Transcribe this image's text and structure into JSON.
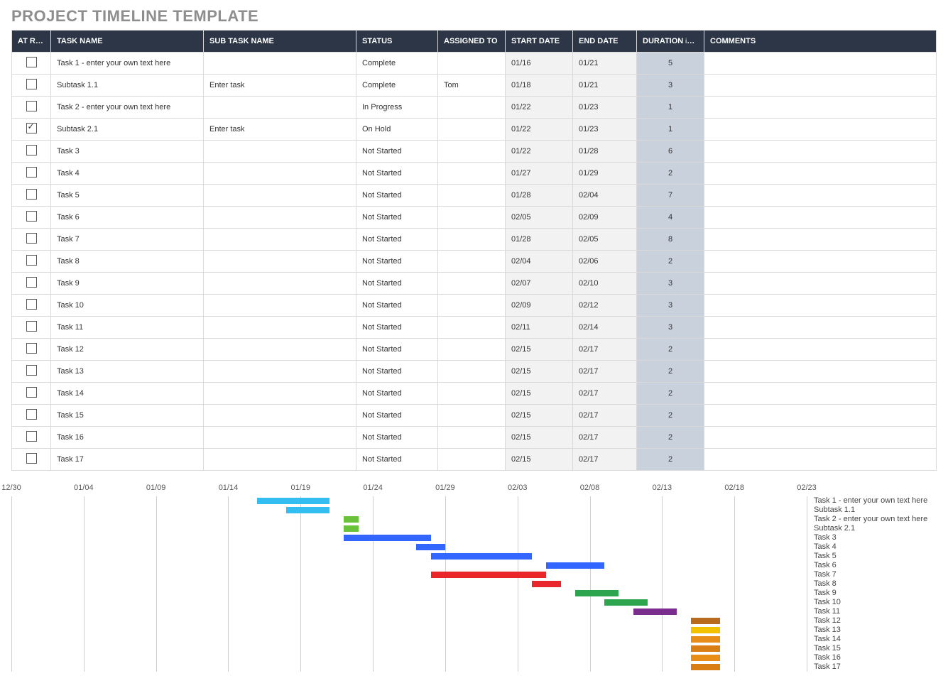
{
  "title": "PROJECT TIMELINE TEMPLATE",
  "columns": {
    "at_risk": "AT RISK",
    "task_name": "TASK NAME",
    "sub_task_name": "SUB TASK NAME",
    "status": "STATUS",
    "assigned_to": "ASSIGNED TO",
    "start_date": "START DATE",
    "end_date": "END DATE",
    "duration": "DURATION",
    "duration_sub": " in days",
    "comments": "COMMENTS"
  },
  "rows": [
    {
      "at_risk": false,
      "task": "Task 1 - enter your own text here",
      "sub": "",
      "status": "Complete",
      "assigned": "",
      "start": "01/16",
      "end": "01/21",
      "duration": "5",
      "comments": ""
    },
    {
      "at_risk": false,
      "task": "Subtask 1.1",
      "sub": "Enter task",
      "status": "Complete",
      "assigned": "Tom",
      "start": "01/18",
      "end": "01/21",
      "duration": "3",
      "comments": ""
    },
    {
      "at_risk": false,
      "task": "Task 2 - enter your own text here",
      "sub": "",
      "status": "In Progress",
      "assigned": "",
      "start": "01/22",
      "end": "01/23",
      "duration": "1",
      "comments": ""
    },
    {
      "at_risk": true,
      "task": "Subtask 2.1",
      "sub": "Enter task",
      "status": "On Hold",
      "assigned": "",
      "start": "01/22",
      "end": "01/23",
      "duration": "1",
      "comments": ""
    },
    {
      "at_risk": false,
      "task": "Task 3",
      "sub": "",
      "status": "Not Started",
      "assigned": "",
      "start": "01/22",
      "end": "01/28",
      "duration": "6",
      "comments": ""
    },
    {
      "at_risk": false,
      "task": "Task 4",
      "sub": "",
      "status": "Not Started",
      "assigned": "",
      "start": "01/27",
      "end": "01/29",
      "duration": "2",
      "comments": ""
    },
    {
      "at_risk": false,
      "task": "Task 5",
      "sub": "",
      "status": "Not Started",
      "assigned": "",
      "start": "01/28",
      "end": "02/04",
      "duration": "7",
      "comments": ""
    },
    {
      "at_risk": false,
      "task": "Task 6",
      "sub": "",
      "status": "Not Started",
      "assigned": "",
      "start": "02/05",
      "end": "02/09",
      "duration": "4",
      "comments": ""
    },
    {
      "at_risk": false,
      "task": "Task 7",
      "sub": "",
      "status": "Not Started",
      "assigned": "",
      "start": "01/28",
      "end": "02/05",
      "duration": "8",
      "comments": ""
    },
    {
      "at_risk": false,
      "task": "Task 8",
      "sub": "",
      "status": "Not Started",
      "assigned": "",
      "start": "02/04",
      "end": "02/06",
      "duration": "2",
      "comments": ""
    },
    {
      "at_risk": false,
      "task": "Task 9",
      "sub": "",
      "status": "Not Started",
      "assigned": "",
      "start": "02/07",
      "end": "02/10",
      "duration": "3",
      "comments": ""
    },
    {
      "at_risk": false,
      "task": "Task 10",
      "sub": "",
      "status": "Not Started",
      "assigned": "",
      "start": "02/09",
      "end": "02/12",
      "duration": "3",
      "comments": ""
    },
    {
      "at_risk": false,
      "task": "Task 11",
      "sub": "",
      "status": "Not Started",
      "assigned": "",
      "start": "02/11",
      "end": "02/14",
      "duration": "3",
      "comments": ""
    },
    {
      "at_risk": false,
      "task": "Task 12",
      "sub": "",
      "status": "Not Started",
      "assigned": "",
      "start": "02/15",
      "end": "02/17",
      "duration": "2",
      "comments": ""
    },
    {
      "at_risk": false,
      "task": "Task 13",
      "sub": "",
      "status": "Not Started",
      "assigned": "",
      "start": "02/15",
      "end": "02/17",
      "duration": "2",
      "comments": ""
    },
    {
      "at_risk": false,
      "task": "Task 14",
      "sub": "",
      "status": "Not Started",
      "assigned": "",
      "start": "02/15",
      "end": "02/17",
      "duration": "2",
      "comments": ""
    },
    {
      "at_risk": false,
      "task": "Task 15",
      "sub": "",
      "status": "Not Started",
      "assigned": "",
      "start": "02/15",
      "end": "02/17",
      "duration": "2",
      "comments": ""
    },
    {
      "at_risk": false,
      "task": "Task 16",
      "sub": "",
      "status": "Not Started",
      "assigned": "",
      "start": "02/15",
      "end": "02/17",
      "duration": "2",
      "comments": ""
    },
    {
      "at_risk": false,
      "task": "Task 17",
      "sub": "",
      "status": "Not Started",
      "assigned": "",
      "start": "02/15",
      "end": "02/17",
      "duration": "2",
      "comments": ""
    }
  ],
  "chart_data": {
    "type": "gantt",
    "x_ticks": [
      "12/30",
      "01/04",
      "01/09",
      "01/14",
      "01/19",
      "01/24",
      "01/29",
      "02/03",
      "02/08",
      "02/13",
      "02/18",
      "02/23"
    ],
    "x_range_days": {
      "start": "12/30",
      "end": "02/23",
      "total_days": 55
    },
    "bars": [
      {
        "label": "Task 1 - enter your own text here",
        "start": "01/16",
        "end": "01/21",
        "color": "#33bef2"
      },
      {
        "label": "Subtask 1.1",
        "start": "01/18",
        "end": "01/21",
        "color": "#33bef2"
      },
      {
        "label": "Task 2 - enter your own text here",
        "start": "01/22",
        "end": "01/23",
        "color": "#6ac23a"
      },
      {
        "label": "Subtask 2.1",
        "start": "01/22",
        "end": "01/23",
        "color": "#6ac23a"
      },
      {
        "label": "Task 3",
        "start": "01/22",
        "end": "01/28",
        "color": "#3366ff"
      },
      {
        "label": "Task 4",
        "start": "01/27",
        "end": "01/29",
        "color": "#3366ff"
      },
      {
        "label": "Task 5",
        "start": "01/28",
        "end": "02/04",
        "color": "#3366ff"
      },
      {
        "label": "Task 6",
        "start": "02/05",
        "end": "02/09",
        "color": "#3366ff"
      },
      {
        "label": "Task 7",
        "start": "01/28",
        "end": "02/05",
        "color": "#e8262c"
      },
      {
        "label": "Task 8",
        "start": "02/04",
        "end": "02/06",
        "color": "#e8262c"
      },
      {
        "label": "Task 9",
        "start": "02/07",
        "end": "02/10",
        "color": "#2da44e"
      },
      {
        "label": "Task 10",
        "start": "02/09",
        "end": "02/12",
        "color": "#2da44e"
      },
      {
        "label": "Task 11",
        "start": "02/11",
        "end": "02/14",
        "color": "#7b2d8e"
      },
      {
        "label": "Task 12",
        "start": "02/15",
        "end": "02/17",
        "color": "#b86b1e"
      },
      {
        "label": "Task 13",
        "start": "02/15",
        "end": "02/17",
        "color": "#f2c200"
      },
      {
        "label": "Task 14",
        "start": "02/15",
        "end": "02/17",
        "color": "#e88c1a"
      },
      {
        "label": "Task 15",
        "start": "02/15",
        "end": "02/17",
        "color": "#d97e14"
      },
      {
        "label": "Task 16",
        "start": "02/15",
        "end": "02/17",
        "color": "#e88c1a"
      },
      {
        "label": "Task 17",
        "start": "02/15",
        "end": "02/17",
        "color": "#d97e14"
      }
    ]
  }
}
